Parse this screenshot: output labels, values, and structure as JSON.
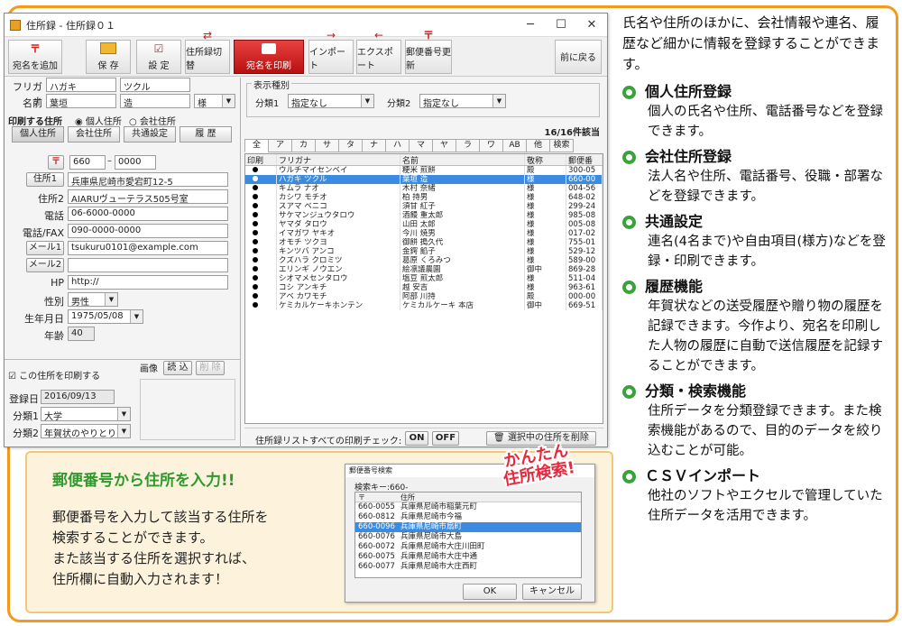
{
  "window": {
    "title": "住所録 - 住所録０１",
    "min": "─",
    "max": "☐",
    "close": "✕"
  },
  "toolbar": [
    {
      "label": "宛名を追加",
      "icon": "〒"
    },
    {
      "label": "保 存",
      "icon": "📁"
    },
    {
      "label": "設 定",
      "icon": "☑"
    },
    {
      "label": "住所録切替",
      "icon": "⇄"
    },
    {
      "label": "宛名を印刷",
      "icon": "🖨"
    },
    {
      "label": "インポート",
      "icon": "→"
    },
    {
      "label": "エクスポート",
      "icon": "←"
    },
    {
      "label": "郵便番号更新",
      "icon": "〒"
    },
    {
      "label": "前に戻る",
      "icon": ""
    }
  ],
  "form": {
    "furigana_label": "フリガナ",
    "furigana_last": "ハガキ",
    "furigana_first": "ツクル",
    "name_label": "名前",
    "name_last": "葉垣",
    "name_first": "造",
    "honorific": "様",
    "print_addr_label": "印刷する住所",
    "radio_personal": "個人住所",
    "radio_company": "会社住所",
    "tab_personal": "個人住所",
    "tab_company": "会社住所",
    "tab_common": "共通設定",
    "tab_history": "履 歴",
    "zip_btn": "〒",
    "zip1": "660",
    "zip2": "0000",
    "addr1_btn": "住所1",
    "addr1": "兵庫県尼崎市愛宕町12-5",
    "addr2_label": "住所2",
    "addr2": "AIARUヴューテラス505号室",
    "tel_label": "電話",
    "tel": "06-6000-0000",
    "fax_label": "電話/FAX",
    "fax": "090-0000-0000",
    "mail1_btn": "メール1",
    "mail1": "tsukuru0101@example.com",
    "mail2_btn": "メール2",
    "mail2": "",
    "hp_label": "HP",
    "hp": "http://",
    "gender_label": "性別",
    "gender": "男性",
    "birth_label": "生年月日",
    "birth": "1975/05/08",
    "age_label": "年齢",
    "age": "40",
    "print_check_label": "この住所を印刷する",
    "image_label": "画像",
    "image_load": "読 込",
    "image_del": "削 除",
    "reg_label": "登録日",
    "reg": "2016/09/13",
    "cat1_label": "分類1",
    "cat1": "大学",
    "cat2_label": "分類2",
    "cat2": "年賀状のやりとりの"
  },
  "filter": {
    "group_label": "表示種別",
    "cat1_label": "分類1",
    "cat1": "指定なし",
    "cat2_label": "分類2",
    "cat2": "指定なし",
    "count": "16/16件該当"
  },
  "alpha_tabs": [
    "全",
    "ア",
    "カ",
    "サ",
    "タ",
    "ナ",
    "ハ",
    "マ",
    "ヤ",
    "ラ",
    "ワ",
    "AB",
    "他",
    "検索"
  ],
  "list": {
    "headers": [
      "印刷",
      "フリガナ",
      "名前",
      "敬称",
      "郵便番"
    ],
    "rows": [
      {
        "f": "ウルチマイセンベイ",
        "n": "粳米 煎餅",
        "h": "殿",
        "z": "300-05"
      },
      {
        "f": "ハガキ ツクル",
        "n": "葉垣 造",
        "h": "様",
        "z": "660-00"
      },
      {
        "f": "キムラ ナオ",
        "n": "木村 奈緒",
        "h": "様",
        "z": "004-56"
      },
      {
        "f": "カシワ モチオ",
        "n": "柏 持男",
        "h": "様",
        "z": "648-02"
      },
      {
        "f": "スアマ ベニコ",
        "n": "須甘 紅子",
        "h": "様",
        "z": "299-24"
      },
      {
        "f": "サケマンジュウタロウ",
        "n": "酒饅 重太郎",
        "h": "様",
        "z": "985-08"
      },
      {
        "f": "ヤマダ タロウ",
        "n": "山田 太郎",
        "h": "様",
        "z": "005-08"
      },
      {
        "f": "イマガワ ヤキオ",
        "n": "今川 焼男",
        "h": "様",
        "z": "017-02"
      },
      {
        "f": "オモチ ツクヨ",
        "n": "御餅 搗久代",
        "h": "様",
        "z": "755-01"
      },
      {
        "f": "キンツバ アンコ",
        "n": "金鍔 餡子",
        "h": "様",
        "z": "529-12"
      },
      {
        "f": "クズハラ クロミツ",
        "n": "葛原 くろみつ",
        "h": "様",
        "z": "589-00"
      },
      {
        "f": "エリンギ ノウエン",
        "n": "絵凛議農園",
        "h": "御中",
        "z": "869-28"
      },
      {
        "f": "シオマメセンタロウ",
        "n": "塩豆 煎太郎",
        "h": "様",
        "z": "511-04"
      },
      {
        "f": "コシ アンキチ",
        "n": "越 安吉",
        "h": "様",
        "z": "963-61"
      },
      {
        "f": "アベ カワモチ",
        "n": "阿部 川持",
        "h": "殿",
        "z": "000-00"
      },
      {
        "f": "ケミカルケーキホンテン",
        "n": "ケミカルケーキ 本店",
        "h": "御中",
        "z": "669-51"
      }
    ]
  },
  "bottom": {
    "check_label": "住所録リストすべての印刷チェック:",
    "on": "ON",
    "off": "OFF",
    "delete": "選択中の住所を削除"
  },
  "callout": {
    "title": "郵便番号から住所を入力!!",
    "body": [
      "郵便番号を入力して該当する住所を",
      "検索することができます。",
      "また該当する住所を選択すれば、",
      "住所欄に自動入力されます！"
    ]
  },
  "dialog": {
    "title": "郵便番号検索",
    "search_label": "検索キー:660-",
    "col_zip": "〒",
    "col_addr": "住所",
    "rows": [
      {
        "z": "660-0055",
        "a": "兵庫県尼崎市稲葉元町"
      },
      {
        "z": "660-0812",
        "a": "兵庫県尼崎市今福"
      },
      {
        "z": "660-0096",
        "a": "兵庫県尼崎市扇町"
      },
      {
        "z": "660-0076",
        "a": "兵庫県尼崎市大島"
      },
      {
        "z": "660-0072",
        "a": "兵庫県尼崎市大庄川田町"
      },
      {
        "z": "660-0075",
        "a": "兵庫県尼崎市大庄中通"
      },
      {
        "z": "660-0077",
        "a": "兵庫県尼崎市大庄西町"
      }
    ],
    "ok": "OK",
    "cancel": "キャンセル"
  },
  "badge": {
    "line1": "かんたん",
    "line2": "住所検索!"
  },
  "description": {
    "intro": "氏名や住所のほかに、会社情報や連名、履歴など細かに情報を登録することができます。",
    "sections": [
      {
        "title": "個人住所登録",
        "body": "個人の氏名や住所、電話番号などを登録できます。"
      },
      {
        "title": "会社住所登録",
        "body": "法人名や住所、電話番号、役職・部署などを登録できます。"
      },
      {
        "title": "共通設定",
        "body": "連名(4名まで)や自由項目(様方)などを登録・印刷できます。"
      },
      {
        "title": "履歴機能",
        "body": "年賀状などの送受履歴や贈り物の履歴を記録できます。今作より、宛名を印刷した人物の履歴に自動で送信履歴を記録することができます。"
      },
      {
        "title": "分類・検索機能",
        "body": "住所データを分類登録できます。また検索機能があるので、目的のデータを絞り込むことが可能。"
      },
      {
        "title": "ＣＳＶインポート",
        "body": "他社のソフトやエクセルで管理していた住所データを活用できます。"
      }
    ]
  },
  "colors": {
    "orange": "#f39a1c",
    "green": "#3aa23a",
    "red_button": "#d42020",
    "select_blue": "#3b8ce0",
    "badge_red": "#e8283c"
  }
}
